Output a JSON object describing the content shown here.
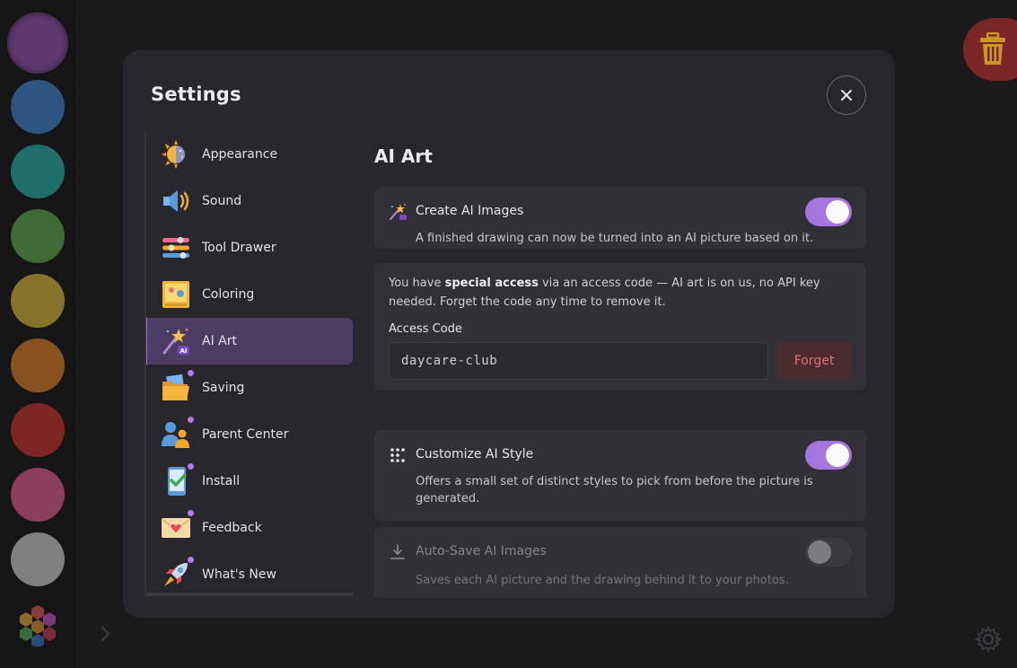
{
  "modal": {
    "title": "Settings",
    "close_icon": "close-icon"
  },
  "nav": [
    {
      "label": "Appearance",
      "icon": "sun-moon-icon",
      "dot": false
    },
    {
      "label": "Sound",
      "icon": "speaker-icon",
      "dot": false
    },
    {
      "label": "Tool Drawer",
      "icon": "sliders-icon",
      "dot": false
    },
    {
      "label": "Coloring",
      "icon": "coloring-page-icon",
      "dot": false
    },
    {
      "label": "AI Art",
      "icon": "magic-wand-icon",
      "dot": false,
      "active": true
    },
    {
      "label": "Saving",
      "icon": "folder-icon",
      "dot": true
    },
    {
      "label": "Parent Center",
      "icon": "people-icon",
      "dot": true
    },
    {
      "label": "Install",
      "icon": "phone-check-icon",
      "dot": true
    },
    {
      "label": "Feedback",
      "icon": "envelope-heart-icon",
      "dot": true
    },
    {
      "label": "What's New",
      "icon": "rocket-icon",
      "dot": true
    }
  ],
  "content": {
    "title": "AI Art",
    "create": {
      "title": "Create AI Images",
      "desc": "A finished drawing can now be turned into an AI picture based on it.",
      "enabled": true
    },
    "access": {
      "text_before": "You have ",
      "text_bold": "special access",
      "text_after": " via an access code — AI art is on us, no API key needed. Forget the code any time to remove it.",
      "code_label": "Access Code",
      "code_value": "daycare-club",
      "forget_label": "Forget"
    },
    "style": {
      "title": "Customize AI Style",
      "desc": "Offers a small set of distinct styles to pick from before the picture is generated.",
      "enabled": true
    },
    "autosave": {
      "title": "Auto-Save AI Images",
      "desc": "Saves each AI picture and the drawing behind it to your photos.",
      "enabled": false
    }
  },
  "colors": {
    "swatches": [
      "#5c3a70",
      "#2e5580",
      "#1f6e6a",
      "#3f6a33",
      "#847427",
      "#87521e",
      "#7e2626",
      "#8c3f5d",
      "#808080"
    ],
    "accent": "#a575e0",
    "forget": "#e87070"
  }
}
